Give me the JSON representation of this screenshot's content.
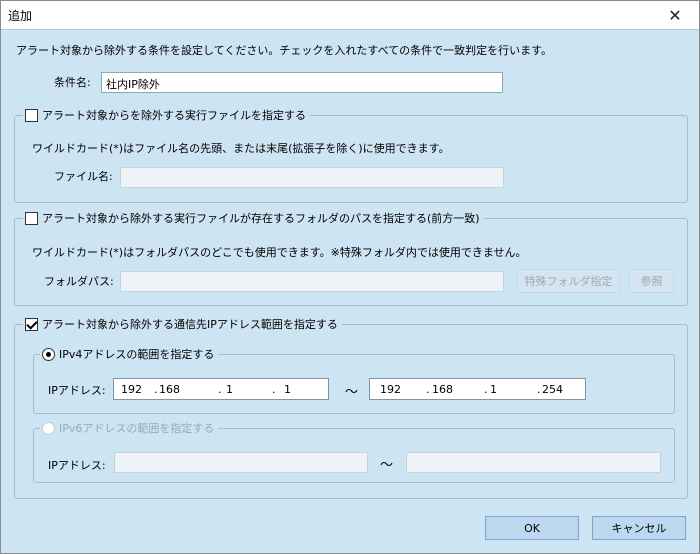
{
  "window": {
    "title": "追加"
  },
  "description": "アラート対象から除外する条件を設定してください。チェックを入れたすべての条件で一致判定を行います。",
  "condition_name": {
    "label": "条件名:",
    "value": "社内IP除外"
  },
  "exe_section": {
    "label": "アラート対象からを除外する実行ファイルを指定する",
    "checked": false,
    "note": "ワイルドカード(*)はファイル名の先頭、または末尾(拡張子を除く)に使用できます。",
    "file_label": "ファイル名:",
    "file_value": ""
  },
  "folder_section": {
    "label": "アラート対象から除外する実行ファイルが存在するフォルダのパスを指定する(前方一致)",
    "checked": false,
    "note": "ワイルドカード(*)はフォルダパスのどこでも使用できます。※特殊フォルダ内では使用できません。",
    "path_label": "フォルダパス:",
    "path_value": "",
    "special_button": "特殊フォルダ指定",
    "browse_button": "参照"
  },
  "ip_section": {
    "label": "アラート対象から除外する通信先IPアドレス範囲を指定する",
    "checked": true,
    "ipv4": {
      "label": "IPv4アドレスの範囲を指定する",
      "selected": true,
      "ip_label": "IPアドレス:",
      "from": [
        "192",
        "168",
        "1",
        "1"
      ],
      "to": [
        "192",
        "168",
        "1",
        "254"
      ],
      "separator": "～"
    },
    "ipv6": {
      "label": "IPv6アドレスの範囲を指定する",
      "selected": false,
      "ip_label": "IPアドレス:",
      "from": "",
      "to": "",
      "separator": "～"
    }
  },
  "buttons": {
    "ok": "OK",
    "cancel": "キャンセル"
  },
  "colors": {
    "dialog_bg": "#cde4f3",
    "button_bg": "#bcd7ee",
    "button_border": "#7aa7cf"
  },
  "icons": {
    "close": "close-icon",
    "checkbox": "checkbox",
    "radio": "radio"
  }
}
